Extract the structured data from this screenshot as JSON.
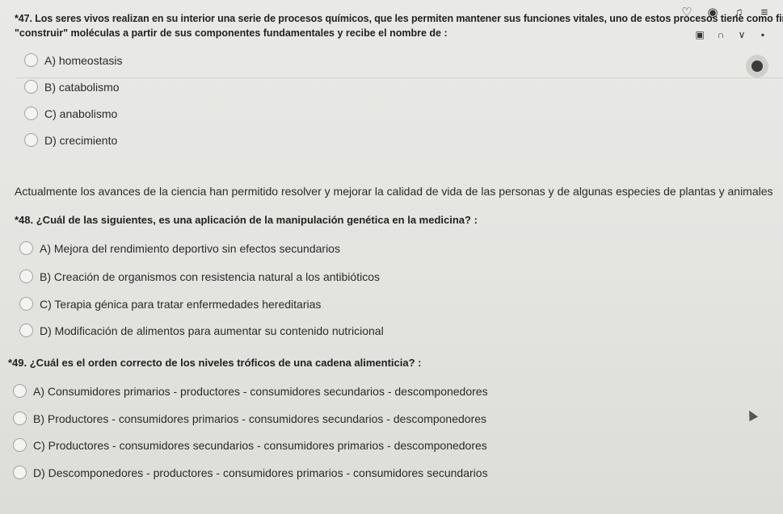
{
  "toolbar": {
    "icons": [
      "heart-icon",
      "user-circle-icon",
      "bell-icon",
      "menu-icon"
    ],
    "sub_icons": [
      "sidebar-icon",
      "bookmark-icon",
      "chevron-down-icon",
      "square-icon"
    ]
  },
  "q47": {
    "line1": "*47. Los seres vivos realizan en su interior una serie de procesos químicos, que les permiten mantener sus funciones vitales, uno de estos procesos tiene como finalidad",
    "line2": "\"construir\" moléculas a partir de sus componentes fundamentales y recibe el nombre de :",
    "options": [
      "A) homeostasis",
      "B) catabolismo",
      "C) anabolismo",
      "D) crecimiento"
    ]
  },
  "context": "Actualmente los avances de la ciencia han permitido resolver y mejorar la calidad de vida de las personas y de algunas especies de plantas y animales",
  "q48": {
    "text": "*48. ¿Cuál de las siguientes, es una aplicación de la manipulación genética en la medicina? :",
    "options": [
      "A) Mejora del rendimiento deportivo sin efectos secundarios",
      "B) Creación de organismos con resistencia natural a los antibióticos",
      "C) Terapia génica para tratar enfermedades hereditarias",
      "D) Modificación de alimentos para aumentar su contenido nutricional"
    ]
  },
  "q49": {
    "text": "*49. ¿Cuál es el orden correcto de los niveles tróficos de una cadena alimenticia? :",
    "options": [
      "A) Consumidores primarios - productores - consumidores secundarios - descomponedores",
      "B) Productores - consumidores primarios - consumidores secundarios - descomponedores",
      "C) Productores - consumidores secundarios - consumidores primarios - descomponedores",
      "D) Descomponedores - productores - consumidores primarios - consumidores secundarios"
    ]
  }
}
